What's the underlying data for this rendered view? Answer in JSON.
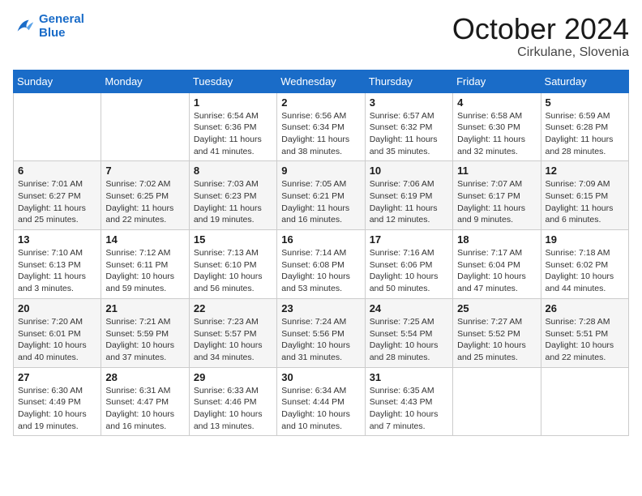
{
  "header": {
    "logo_general": "General",
    "logo_blue": "Blue",
    "month_year": "October 2024",
    "location": "Cirkulane, Slovenia"
  },
  "weekdays": [
    "Sunday",
    "Monday",
    "Tuesday",
    "Wednesday",
    "Thursday",
    "Friday",
    "Saturday"
  ],
  "weeks": [
    [
      {
        "day": "",
        "sunrise": "",
        "sunset": "",
        "daylight": ""
      },
      {
        "day": "",
        "sunrise": "",
        "sunset": "",
        "daylight": ""
      },
      {
        "day": "1",
        "sunrise": "Sunrise: 6:54 AM",
        "sunset": "Sunset: 6:36 PM",
        "daylight": "Daylight: 11 hours and 41 minutes."
      },
      {
        "day": "2",
        "sunrise": "Sunrise: 6:56 AM",
        "sunset": "Sunset: 6:34 PM",
        "daylight": "Daylight: 11 hours and 38 minutes."
      },
      {
        "day": "3",
        "sunrise": "Sunrise: 6:57 AM",
        "sunset": "Sunset: 6:32 PM",
        "daylight": "Daylight: 11 hours and 35 minutes."
      },
      {
        "day": "4",
        "sunrise": "Sunrise: 6:58 AM",
        "sunset": "Sunset: 6:30 PM",
        "daylight": "Daylight: 11 hours and 32 minutes."
      },
      {
        "day": "5",
        "sunrise": "Sunrise: 6:59 AM",
        "sunset": "Sunset: 6:28 PM",
        "daylight": "Daylight: 11 hours and 28 minutes."
      }
    ],
    [
      {
        "day": "6",
        "sunrise": "Sunrise: 7:01 AM",
        "sunset": "Sunset: 6:27 PM",
        "daylight": "Daylight: 11 hours and 25 minutes."
      },
      {
        "day": "7",
        "sunrise": "Sunrise: 7:02 AM",
        "sunset": "Sunset: 6:25 PM",
        "daylight": "Daylight: 11 hours and 22 minutes."
      },
      {
        "day": "8",
        "sunrise": "Sunrise: 7:03 AM",
        "sunset": "Sunset: 6:23 PM",
        "daylight": "Daylight: 11 hours and 19 minutes."
      },
      {
        "day": "9",
        "sunrise": "Sunrise: 7:05 AM",
        "sunset": "Sunset: 6:21 PM",
        "daylight": "Daylight: 11 hours and 16 minutes."
      },
      {
        "day": "10",
        "sunrise": "Sunrise: 7:06 AM",
        "sunset": "Sunset: 6:19 PM",
        "daylight": "Daylight: 11 hours and 12 minutes."
      },
      {
        "day": "11",
        "sunrise": "Sunrise: 7:07 AM",
        "sunset": "Sunset: 6:17 PM",
        "daylight": "Daylight: 11 hours and 9 minutes."
      },
      {
        "day": "12",
        "sunrise": "Sunrise: 7:09 AM",
        "sunset": "Sunset: 6:15 PM",
        "daylight": "Daylight: 11 hours and 6 minutes."
      }
    ],
    [
      {
        "day": "13",
        "sunrise": "Sunrise: 7:10 AM",
        "sunset": "Sunset: 6:13 PM",
        "daylight": "Daylight: 11 hours and 3 minutes."
      },
      {
        "day": "14",
        "sunrise": "Sunrise: 7:12 AM",
        "sunset": "Sunset: 6:11 PM",
        "daylight": "Daylight: 10 hours and 59 minutes."
      },
      {
        "day": "15",
        "sunrise": "Sunrise: 7:13 AM",
        "sunset": "Sunset: 6:10 PM",
        "daylight": "Daylight: 10 hours and 56 minutes."
      },
      {
        "day": "16",
        "sunrise": "Sunrise: 7:14 AM",
        "sunset": "Sunset: 6:08 PM",
        "daylight": "Daylight: 10 hours and 53 minutes."
      },
      {
        "day": "17",
        "sunrise": "Sunrise: 7:16 AM",
        "sunset": "Sunset: 6:06 PM",
        "daylight": "Daylight: 10 hours and 50 minutes."
      },
      {
        "day": "18",
        "sunrise": "Sunrise: 7:17 AM",
        "sunset": "Sunset: 6:04 PM",
        "daylight": "Daylight: 10 hours and 47 minutes."
      },
      {
        "day": "19",
        "sunrise": "Sunrise: 7:18 AM",
        "sunset": "Sunset: 6:02 PM",
        "daylight": "Daylight: 10 hours and 44 minutes."
      }
    ],
    [
      {
        "day": "20",
        "sunrise": "Sunrise: 7:20 AM",
        "sunset": "Sunset: 6:01 PM",
        "daylight": "Daylight: 10 hours and 40 minutes."
      },
      {
        "day": "21",
        "sunrise": "Sunrise: 7:21 AM",
        "sunset": "Sunset: 5:59 PM",
        "daylight": "Daylight: 10 hours and 37 minutes."
      },
      {
        "day": "22",
        "sunrise": "Sunrise: 7:23 AM",
        "sunset": "Sunset: 5:57 PM",
        "daylight": "Daylight: 10 hours and 34 minutes."
      },
      {
        "day": "23",
        "sunrise": "Sunrise: 7:24 AM",
        "sunset": "Sunset: 5:56 PM",
        "daylight": "Daylight: 10 hours and 31 minutes."
      },
      {
        "day": "24",
        "sunrise": "Sunrise: 7:25 AM",
        "sunset": "Sunset: 5:54 PM",
        "daylight": "Daylight: 10 hours and 28 minutes."
      },
      {
        "day": "25",
        "sunrise": "Sunrise: 7:27 AM",
        "sunset": "Sunset: 5:52 PM",
        "daylight": "Daylight: 10 hours and 25 minutes."
      },
      {
        "day": "26",
        "sunrise": "Sunrise: 7:28 AM",
        "sunset": "Sunset: 5:51 PM",
        "daylight": "Daylight: 10 hours and 22 minutes."
      }
    ],
    [
      {
        "day": "27",
        "sunrise": "Sunrise: 6:30 AM",
        "sunset": "Sunset: 4:49 PM",
        "daylight": "Daylight: 10 hours and 19 minutes."
      },
      {
        "day": "28",
        "sunrise": "Sunrise: 6:31 AM",
        "sunset": "Sunset: 4:47 PM",
        "daylight": "Daylight: 10 hours and 16 minutes."
      },
      {
        "day": "29",
        "sunrise": "Sunrise: 6:33 AM",
        "sunset": "Sunset: 4:46 PM",
        "daylight": "Daylight: 10 hours and 13 minutes."
      },
      {
        "day": "30",
        "sunrise": "Sunrise: 6:34 AM",
        "sunset": "Sunset: 4:44 PM",
        "daylight": "Daylight: 10 hours and 10 minutes."
      },
      {
        "day": "31",
        "sunrise": "Sunrise: 6:35 AM",
        "sunset": "Sunset: 4:43 PM",
        "daylight": "Daylight: 10 hours and 7 minutes."
      },
      {
        "day": "",
        "sunrise": "",
        "sunset": "",
        "daylight": ""
      },
      {
        "day": "",
        "sunrise": "",
        "sunset": "",
        "daylight": ""
      }
    ]
  ]
}
